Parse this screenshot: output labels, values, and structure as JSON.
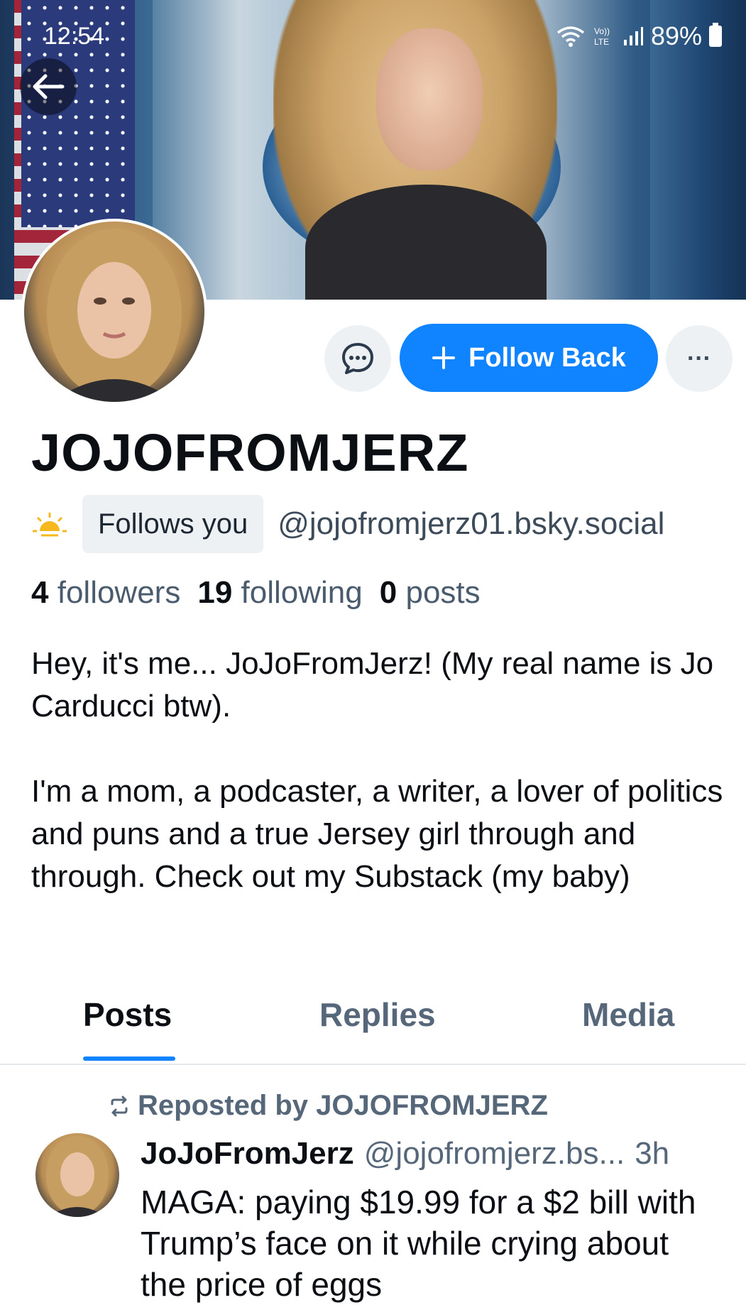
{
  "status_bar": {
    "time": "12:54",
    "battery": "89%"
  },
  "profile": {
    "display_name": "JOJOFROMJERZ",
    "follows_badge": "Follows you",
    "handle": "@jojofromjerz01.bsky.social",
    "stats": {
      "followers_count": "4",
      "followers_label": "followers",
      "following_count": "19",
      "following_label": "following",
      "posts_count": "0",
      "posts_label": "posts"
    },
    "bio_paragraphs": [
      "Hey, it's me... JoJoFromJerz! (My real name is Jo Carducci btw).",
      "I'm a mom, a podcaster, a writer, a lover of politics and puns and a true Jersey girl through and through. Check out my Substack (my baby)"
    ]
  },
  "actions": {
    "follow_label": "Follow Back",
    "more_label": "···"
  },
  "tabs": [
    {
      "label": "Posts",
      "active": true
    },
    {
      "label": "Replies",
      "active": false
    },
    {
      "label": "Media",
      "active": false
    }
  ],
  "feed": [
    {
      "repost_label": "Reposted by JOJOFROMJERZ",
      "author": "JoJoFromJerz",
      "handle": "@jojofromjerz.bs...",
      "time": "3h",
      "text": "MAGA: paying $19.99 for a $2 bill with Trump’s face on it while crying about the price of eggs"
    }
  ],
  "colors": {
    "accent": "#1083fe",
    "muted_text": "#56677a"
  }
}
